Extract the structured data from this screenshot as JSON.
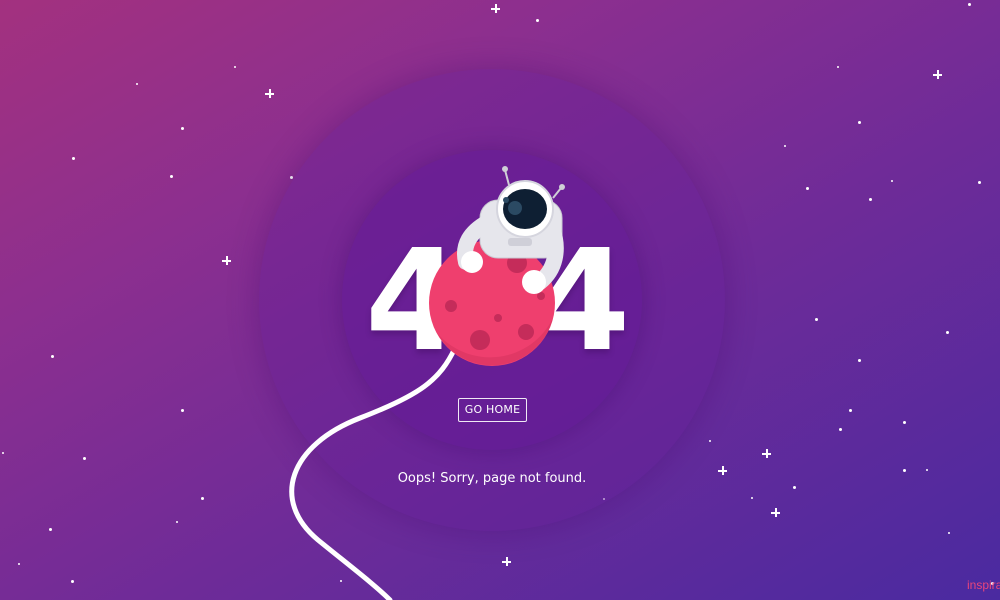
{
  "page": {
    "code_left": "4",
    "code_right": "4",
    "button_label": "GO HOME",
    "message": "Oops! Sorry, page not found.",
    "credit": "inspira"
  },
  "colors": {
    "gradient_start": "#a3317f",
    "gradient_end": "#4a2aa0",
    "planet": "#ef3f6e",
    "crater": "#c52c5a",
    "accent_text": "#e8457c"
  },
  "icons": [
    "astronaut-icon",
    "planet-icon",
    "star-icon"
  ]
}
